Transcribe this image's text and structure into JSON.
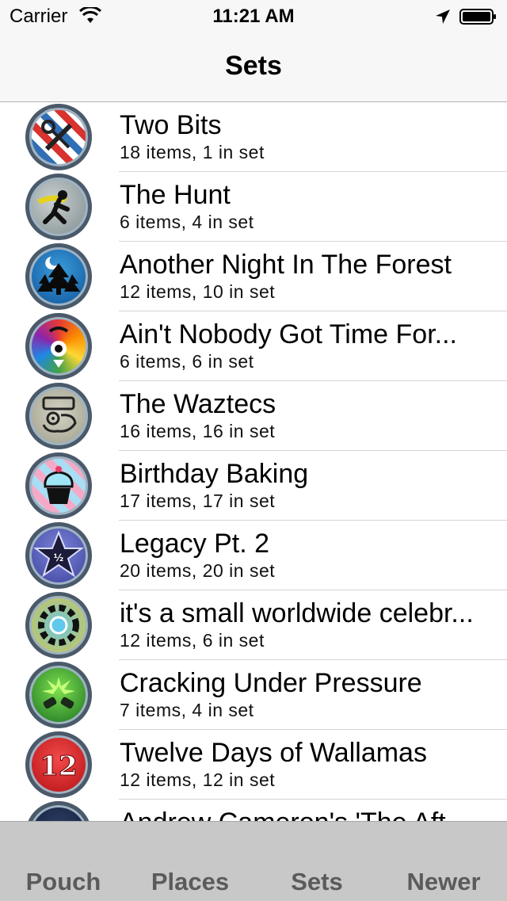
{
  "status_bar": {
    "carrier": "Carrier",
    "time": "11:21 AM"
  },
  "nav": {
    "title": "Sets"
  },
  "sets": [
    {
      "title": "Two Bits",
      "subtitle": "18 items, 1 in set",
      "icon": "barber-pole-scissors-icon"
    },
    {
      "title": "The Hunt",
      "subtitle": "6 items, 4 in set",
      "icon": "running-hunter-icon"
    },
    {
      "title": "Another Night In The Forest",
      "subtitle": "12 items, 10 in set",
      "icon": "forest-moon-icon"
    },
    {
      "title": "Ain't Nobody Got Time For...",
      "subtitle": "6 items, 6 in set",
      "icon": "rainbow-pinwheel-icon"
    },
    {
      "title": "The Waztecs",
      "subtitle": "16 items, 16 in set",
      "icon": "aztec-glyph-icon"
    },
    {
      "title": "Birthday Baking",
      "subtitle": "17 items, 17 in set",
      "icon": "cupcake-icon"
    },
    {
      "title": "Legacy Pt. 2",
      "subtitle": "20 items, 20 in set",
      "icon": "legacy-star-icon"
    },
    {
      "title": "it's a small worldwide celebr...",
      "subtitle": "12 items, 6 in set",
      "icon": "worldwide-ring-icon"
    },
    {
      "title": "Cracking Under Pressure",
      "subtitle": "7 items, 4 in set",
      "icon": "cracker-burst-icon"
    },
    {
      "title": "Twelve Days of Wallamas",
      "subtitle": "12 items, 12 in set",
      "icon": "number-twelve-icon"
    },
    {
      "title": "Andrew Cameron's 'The Aft...",
      "subtitle": "",
      "icon": "dark-badge-icon"
    }
  ],
  "tabs": [
    {
      "label": "Pouch"
    },
    {
      "label": "Places"
    },
    {
      "label": "Sets"
    },
    {
      "label": "Newer"
    }
  ]
}
